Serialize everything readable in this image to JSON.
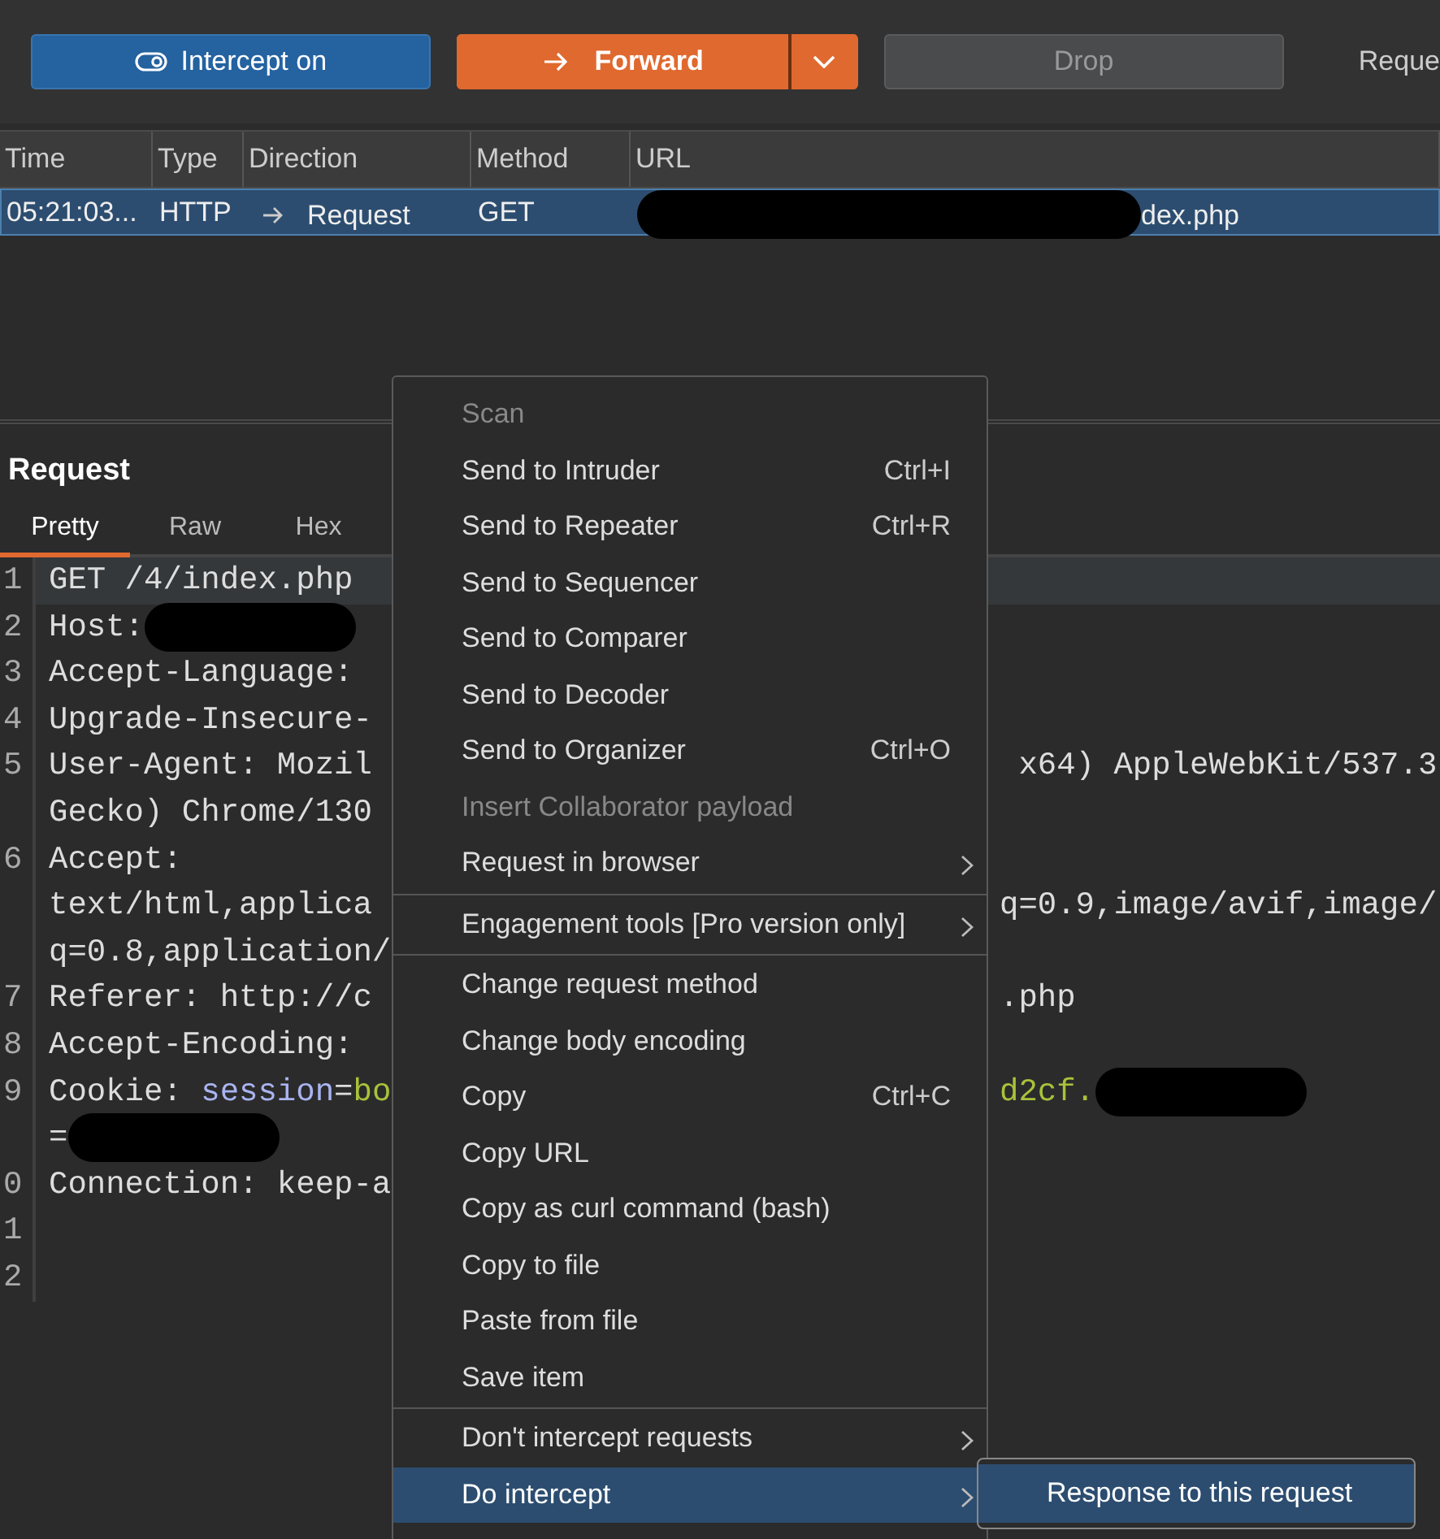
{
  "toolbar": {
    "buttons": [
      {
        "kind": "intercept",
        "label": "Intercept on"
      },
      {
        "kind": "forward",
        "label": "Forward"
      },
      {
        "kind": "drop",
        "label": "Drop"
      }
    ],
    "cut_label": "Reque"
  },
  "table": {
    "columns": [
      "Time",
      "Type",
      "Direction",
      "Method",
      "URL"
    ],
    "rows": [
      {
        "selected": true,
        "time": "05:21:03...",
        "type": "HTTP",
        "direction": "Request",
        "method": "GET",
        "url_visible": "dex.php"
      }
    ]
  },
  "request": {
    "title": "Request",
    "tabs": [
      {
        "label": "Pretty",
        "selected": true
      },
      {
        "label": "Raw",
        "selected": false
      },
      {
        "label": "Hex",
        "selected": false
      }
    ],
    "lines": [
      {
        "number": "1",
        "highlighted": true,
        "rows": [
          {
            "left": [
              {
                "kind": "plain",
                "text": "GET /4/index.php"
              }
            ],
            "right": []
          }
        ]
      },
      {
        "number": "2",
        "highlighted": false,
        "rows": [
          {
            "left": [
              {
                "kind": "plain",
                "text": "Host:"
              },
              {
                "kind": "redacted"
              }
            ],
            "right": []
          }
        ]
      },
      {
        "number": "3",
        "highlighted": false,
        "rows": [
          {
            "left": [
              {
                "kind": "plain",
                "text": "Accept-Language:"
              }
            ],
            "right": []
          }
        ]
      },
      {
        "number": "4",
        "highlighted": false,
        "rows": [
          {
            "left": [
              {
                "kind": "plain",
                "text": "Upgrade-Insecure-"
              }
            ],
            "right": []
          }
        ]
      },
      {
        "number": "5",
        "highlighted": false,
        "rows": [
          {
            "left": [
              {
                "kind": "plain",
                "text": "User-Agent: Mozil"
              }
            ],
            "right": [
              {
                "kind": "plain",
                "text": " x64) AppleWebKit/537.3"
              }
            ]
          },
          {
            "left": [
              {
                "kind": "plain",
                "text": "Gecko) Chrome/130"
              }
            ],
            "right": []
          }
        ]
      },
      {
        "number": "6",
        "highlighted": false,
        "rows": [
          {
            "left": [
              {
                "kind": "plain",
                "text": "Accept:"
              }
            ],
            "right": []
          },
          {
            "left": [
              {
                "kind": "plain",
                "text": "text/html,applica"
              }
            ],
            "right": [
              {
                "kind": "plain",
                "text": "q=0.9,image/avif,image/"
              }
            ]
          },
          {
            "left": [
              {
                "kind": "plain",
                "text": "q=0.8,application/"
              }
            ],
            "right": []
          }
        ]
      },
      {
        "number": "7",
        "highlighted": false,
        "rows": [
          {
            "left": [
              {
                "kind": "plain",
                "text": "Referer: http://c"
              }
            ],
            "right": [
              {
                "kind": "plain",
                "text": ".php"
              }
            ]
          }
        ]
      },
      {
        "number": "8",
        "highlighted": false,
        "rows": [
          {
            "left": [
              {
                "kind": "plain",
                "text": "Accept-Encoding:"
              }
            ],
            "right": []
          }
        ]
      },
      {
        "number": "9",
        "highlighted": false,
        "rows": [
          {
            "left": [
              {
                "kind": "plain",
                "text": "Cookie: "
              },
              {
                "kind": "param-name",
                "text": "session"
              },
              {
                "kind": "plain",
                "text": "="
              },
              {
                "kind": "param-value",
                "text": "bo"
              }
            ],
            "right": [
              {
                "kind": "param-value",
                "text": "d2cf."
              },
              {
                "kind": "redacted"
              }
            ]
          },
          {
            "left": [
              {
                "kind": "plain",
                "text": "="
              },
              {
                "kind": "redacted"
              }
            ],
            "right": []
          }
        ]
      },
      {
        "number": "0",
        "highlighted": false,
        "rows": [
          {
            "left": [
              {
                "kind": "plain",
                "text": "Connection: keep-a"
              }
            ],
            "right": []
          }
        ]
      },
      {
        "number": "1",
        "highlighted": false,
        "rows": [
          {
            "left": [],
            "right": []
          }
        ]
      },
      {
        "number": "2",
        "highlighted": false,
        "rows": [
          {
            "left": [],
            "right": []
          }
        ]
      }
    ]
  },
  "context_menu": {
    "items": [
      {
        "kind": "item",
        "label": "Scan",
        "disabled": true,
        "selected": false
      },
      {
        "kind": "item",
        "label": "Send to Intruder",
        "shortcut": "Ctrl+I",
        "disabled": false,
        "selected": false
      },
      {
        "kind": "item",
        "label": "Send to Repeater",
        "shortcut": "Ctrl+R",
        "disabled": false,
        "selected": false
      },
      {
        "kind": "item",
        "label": "Send to Sequencer",
        "disabled": false,
        "selected": false
      },
      {
        "kind": "item",
        "label": "Send to Comparer",
        "disabled": false,
        "selected": false
      },
      {
        "kind": "item",
        "label": "Send to Decoder",
        "disabled": false,
        "selected": false
      },
      {
        "kind": "item",
        "label": "Send to Organizer",
        "shortcut": "Ctrl+O",
        "disabled": false,
        "selected": false
      },
      {
        "kind": "item",
        "label": "Insert Collaborator payload",
        "disabled": true,
        "selected": false
      },
      {
        "kind": "item",
        "label": "Request in browser",
        "submenu": true,
        "disabled": false,
        "selected": false
      },
      {
        "kind": "separator"
      },
      {
        "kind": "item",
        "label": "Engagement tools [Pro version only]",
        "submenu": true,
        "disabled": false,
        "selected": false
      },
      {
        "kind": "separator"
      },
      {
        "kind": "item",
        "label": "Change request method",
        "disabled": false,
        "selected": false
      },
      {
        "kind": "item",
        "label": "Change body encoding",
        "disabled": false,
        "selected": false
      },
      {
        "kind": "item",
        "label": "Copy",
        "shortcut": "Ctrl+C",
        "disabled": false,
        "selected": false
      },
      {
        "kind": "item",
        "label": "Copy URL",
        "disabled": false,
        "selected": false
      },
      {
        "kind": "item",
        "label": "Copy as curl command (bash)",
        "disabled": false,
        "selected": false
      },
      {
        "kind": "item",
        "label": "Copy to file",
        "disabled": false,
        "selected": false
      },
      {
        "kind": "item",
        "label": "Paste from file",
        "disabled": false,
        "selected": false
      },
      {
        "kind": "item",
        "label": "Save item",
        "disabled": false,
        "selected": false
      },
      {
        "kind": "separator"
      },
      {
        "kind": "item",
        "label": "Don't intercept requests",
        "submenu": true,
        "disabled": false,
        "selected": false
      },
      {
        "kind": "item",
        "label": "Do intercept",
        "submenu": true,
        "disabled": false,
        "selected": true,
        "children": [
          {
            "label": "Response to this request",
            "selected": true
          }
        ]
      }
    ]
  }
}
